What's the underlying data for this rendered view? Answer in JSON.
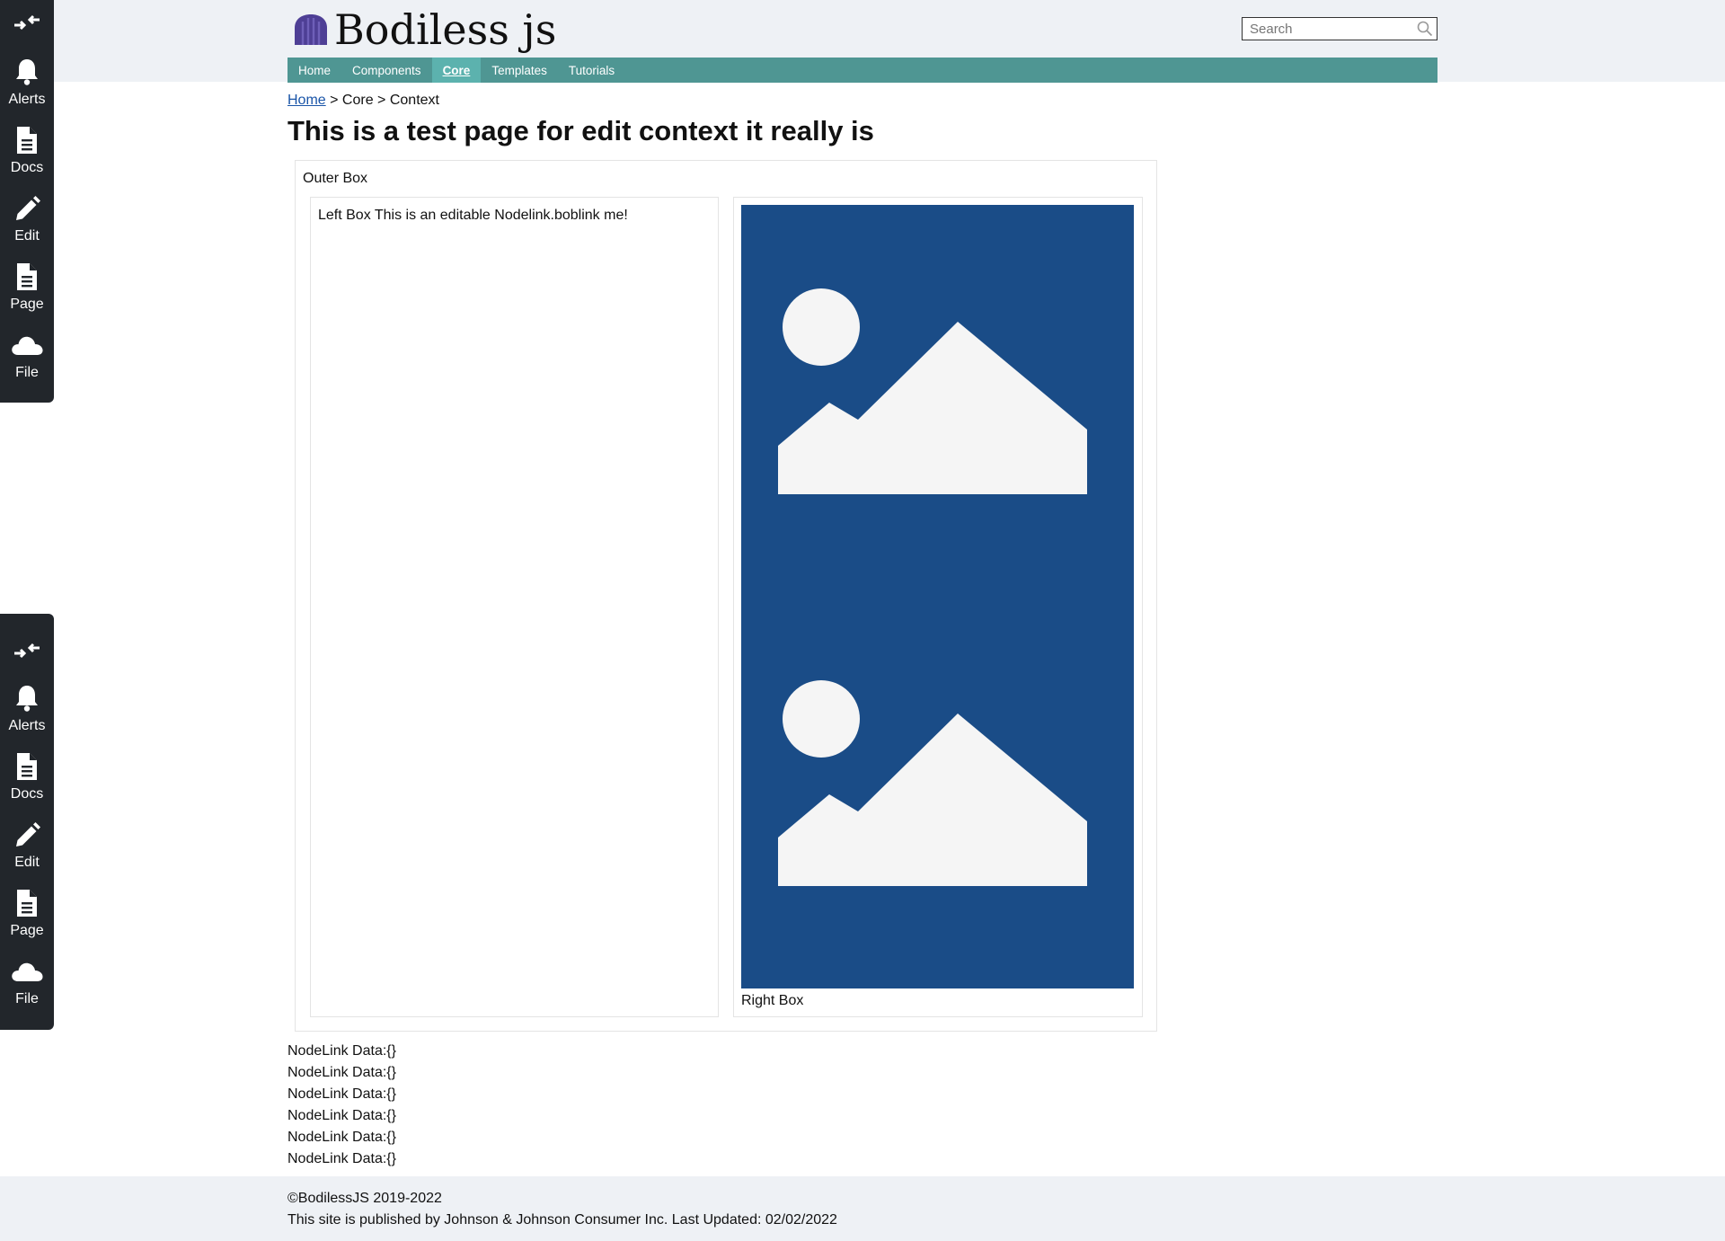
{
  "toolbar": {
    "items": [
      {
        "label": "Alerts",
        "icon": "bell-icon"
      },
      {
        "label": "Docs",
        "icon": "document-icon"
      },
      {
        "label": "Edit",
        "icon": "pencil-icon"
      },
      {
        "label": "Page",
        "icon": "page-icon"
      },
      {
        "label": "File",
        "icon": "cloud-icon"
      }
    ]
  },
  "header": {
    "logo_text": "Bodiless js",
    "search_placeholder": "Search"
  },
  "nav": {
    "items": [
      "Home",
      "Components",
      "Core",
      "Templates",
      "Tutorials"
    ],
    "active": "Core"
  },
  "breadcrumb": {
    "home": "Home",
    "rest": " > Core > Context"
  },
  "page": {
    "title": "This is a test page for edit context it really is",
    "outer_label": "Outer Box",
    "left_text": "Left Box This is an editable Nodelink.boblink me!",
    "right_label": "Right Box"
  },
  "nodelinks": [
    "NodeLink Data:{}",
    "NodeLink Data:{}",
    "NodeLink Data:{}",
    "NodeLink Data:{}",
    "NodeLink Data:{}",
    "NodeLink Data:{}"
  ],
  "footer": {
    "copyright": "©BodilessJS 2019-2022",
    "published": "This site is published by Johnson & Johnson Consumer Inc. Last Updated: 02/02/2022"
  },
  "colors": {
    "nav_bg": "#4f9693",
    "nav_active": "#5cb2ae",
    "toolbar_bg": "#22262b",
    "image_bg": "#1a4c87",
    "header_bg": "#eef1f5"
  }
}
